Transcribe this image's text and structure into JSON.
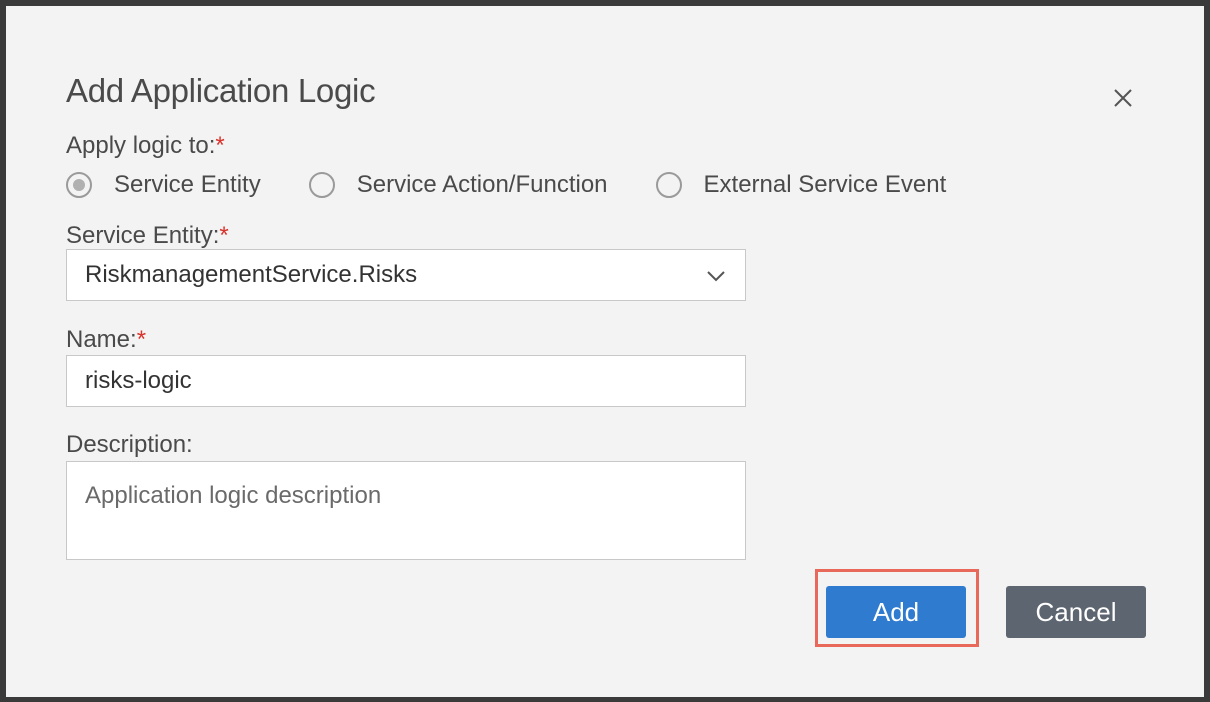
{
  "dialog": {
    "title": "Add Application Logic",
    "close_label": "×"
  },
  "apply_logic": {
    "label": "Apply logic to:",
    "required_mark": "*",
    "options": [
      {
        "label": "Service Entity",
        "selected": true
      },
      {
        "label": "Service Action/Function",
        "selected": false
      },
      {
        "label": "External Service Event",
        "selected": false
      }
    ]
  },
  "service_entity": {
    "label": "Service Entity:",
    "required_mark": "*",
    "value": "RiskmanagementService.Risks"
  },
  "name": {
    "label": "Name:",
    "required_mark": "*",
    "value": "risks-logic"
  },
  "description": {
    "label": "Description:",
    "placeholder": "Application logic description"
  },
  "buttons": {
    "add_label": "Add",
    "cancel_label": "Cancel"
  },
  "colors": {
    "primary": "#2f7bd0",
    "secondary": "#5d6670",
    "highlight": "#e8695a",
    "required": "#d9322b"
  },
  "icons": {
    "close": "close-icon",
    "dropdown": "chevron-down-icon"
  }
}
